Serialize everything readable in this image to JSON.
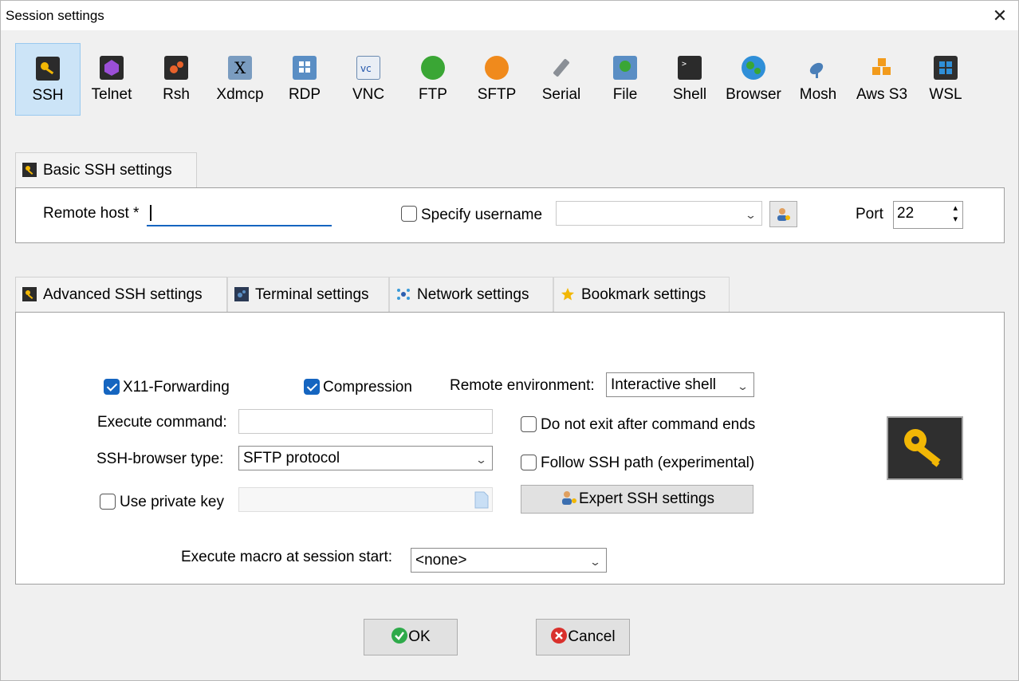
{
  "window": {
    "title": "Session settings",
    "close_glyph": "✕"
  },
  "protocols": [
    {
      "label": "SSH",
      "icon": "ssh-icon",
      "selected": true
    },
    {
      "label": "Telnet",
      "icon": "telnet-icon"
    },
    {
      "label": "Rsh",
      "icon": "rsh-icon"
    },
    {
      "label": "Xdmcp",
      "icon": "xdmcp-icon"
    },
    {
      "label": "RDP",
      "icon": "rdp-icon"
    },
    {
      "label": "VNC",
      "icon": "vnc-icon"
    },
    {
      "label": "FTP",
      "icon": "ftp-icon"
    },
    {
      "label": "SFTP",
      "icon": "sftp-icon"
    },
    {
      "label": "Serial",
      "icon": "serial-icon"
    },
    {
      "label": "File",
      "icon": "file-icon"
    },
    {
      "label": "Shell",
      "icon": "shell-icon"
    },
    {
      "label": "Browser",
      "icon": "browser-icon"
    },
    {
      "label": "Mosh",
      "icon": "mosh-icon"
    },
    {
      "label": "Aws S3",
      "icon": "aws-s3-icon"
    },
    {
      "label": "WSL",
      "icon": "wsl-icon"
    }
  ],
  "basic": {
    "tab_label": "Basic SSH settings",
    "remote_host_label": "Remote host *",
    "remote_host_value": "",
    "specify_username_label": "Specify username",
    "specify_username_checked": false,
    "username_value": "",
    "port_label": "Port",
    "port_value": "22"
  },
  "advanced_tabs": [
    {
      "label": "Advanced SSH settings",
      "icon": "wrench-icon",
      "active": true
    },
    {
      "label": "Terminal settings",
      "icon": "terminal-icon"
    },
    {
      "label": "Network settings",
      "icon": "network-icon"
    },
    {
      "label": "Bookmark settings",
      "icon": "star-icon"
    }
  ],
  "advanced": {
    "x11_label": "X11-Forwarding",
    "x11_checked": true,
    "compression_label": "Compression",
    "compression_checked": true,
    "remote_env_label": "Remote environment:",
    "remote_env_value": "Interactive shell",
    "execute_command_label": "Execute command:",
    "execute_command_value": "",
    "do_not_exit_label": "Do not exit after command ends",
    "do_not_exit_checked": false,
    "ssh_browser_label": "SSH-browser type:",
    "ssh_browser_value": "SFTP protocol",
    "follow_ssh_path_label": "Follow SSH path (experimental)",
    "follow_ssh_path_checked": false,
    "use_private_key_label": "Use private key",
    "use_private_key_checked": false,
    "private_key_value": "",
    "expert_button_label": "Expert SSH settings",
    "macro_label": "Execute macro at session start:",
    "macro_value": "<none>"
  },
  "footer": {
    "ok_label": "OK",
    "cancel_label": "Cancel"
  },
  "colors": {
    "accent": "#1565c0",
    "selected_bg": "#cce4f7",
    "ok_green": "#2eaa4a",
    "cancel_red": "#d9302c"
  }
}
